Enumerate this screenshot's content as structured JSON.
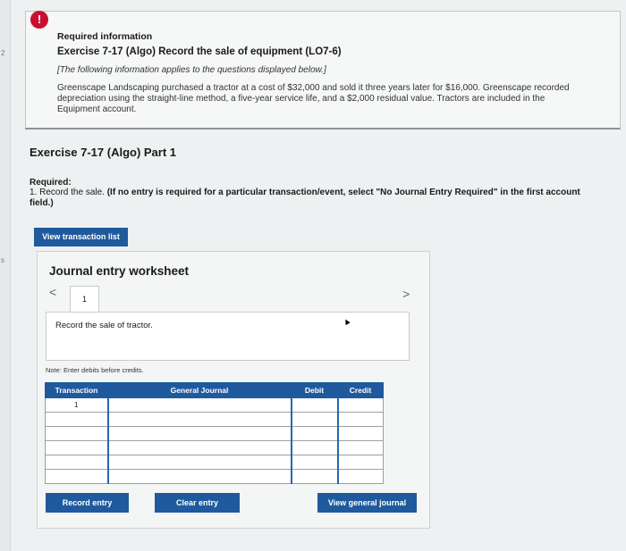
{
  "gutter": {
    "mark_top": "2",
    "mark_mid": "s"
  },
  "info": {
    "alert_icon": "!",
    "title": "Required information",
    "subtitle": "Exercise 7-17 (Algo) Record the sale of equipment (LO7-6)",
    "italic_note": "[The following information applies to the questions displayed below.]",
    "paragraph": "Greenscape Landscaping purchased a tractor at a cost of $32,000 and sold it three years later for $16,000. Greenscape recorded depreciation using the straight-line method, a five-year service life, and a $2,000 residual value. Tractors are included in the Equipment account."
  },
  "part": {
    "title": "Exercise 7-17 (Algo) Part 1",
    "required_heading": "Required:",
    "required_text_plain": "1. Record the sale. ",
    "required_text_bold": "(If no entry is required for a particular transaction/event, select \"No Journal Entry Required\" in the first account field.)"
  },
  "buttons": {
    "view_transaction_list": "View transaction list",
    "record_entry": "Record entry",
    "clear_entry": "Clear entry",
    "view_general_journal": "View general journal"
  },
  "worksheet": {
    "title": "Journal entry worksheet",
    "prev_arrow": "<",
    "next_arrow": ">",
    "tab_label": "1",
    "instruction": "Record the sale of tractor.",
    "note": "Note: Enter debits before credits.",
    "columns": [
      "Transaction",
      "General Journal",
      "Debit",
      "Credit"
    ],
    "rows": [
      {
        "transaction": "1",
        "general_journal": "",
        "debit": "",
        "credit": ""
      },
      {
        "transaction": "",
        "general_journal": "",
        "debit": "",
        "credit": ""
      },
      {
        "transaction": "",
        "general_journal": "",
        "debit": "",
        "credit": ""
      },
      {
        "transaction": "",
        "general_journal": "",
        "debit": "",
        "credit": ""
      },
      {
        "transaction": "",
        "general_journal": "",
        "debit": "",
        "credit": ""
      },
      {
        "transaction": "",
        "general_journal": "",
        "debit": "",
        "credit": ""
      }
    ]
  },
  "colors": {
    "primary_button": "#1f5a9e",
    "alert": "#c8102e"
  }
}
